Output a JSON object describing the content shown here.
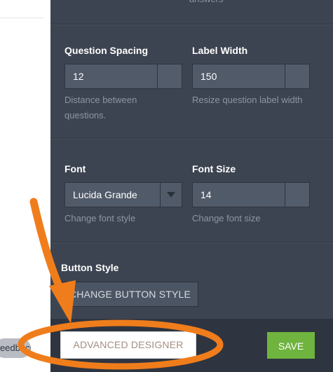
{
  "background": {
    "top_cut_text": "answers",
    "feedback_tab_label": "Feedback"
  },
  "question_spacing": {
    "title": "Question Spacing",
    "value": "12",
    "help": "Distance between questions."
  },
  "label_width": {
    "title": "Label Width",
    "value": "150",
    "help": "Resize question label width"
  },
  "font": {
    "title": "Font",
    "value": "Lucida Grande",
    "help": "Change font style"
  },
  "font_size": {
    "title": "Font Size",
    "value": "14",
    "help": "Change font size"
  },
  "button_style": {
    "title": "Button Style",
    "button_label": "CHANGE BUTTON STYLE"
  },
  "footer": {
    "advanced_designer_label": "ADVANCED DESIGNER",
    "save_label": "SAVE"
  },
  "colors": {
    "panel_bg": "#3d4451",
    "save_green": "#6fb43f",
    "annotation_orange": "#f58220"
  },
  "annotation": {
    "icon": "arrow-icon",
    "highlight": "ellipse-highlight"
  }
}
